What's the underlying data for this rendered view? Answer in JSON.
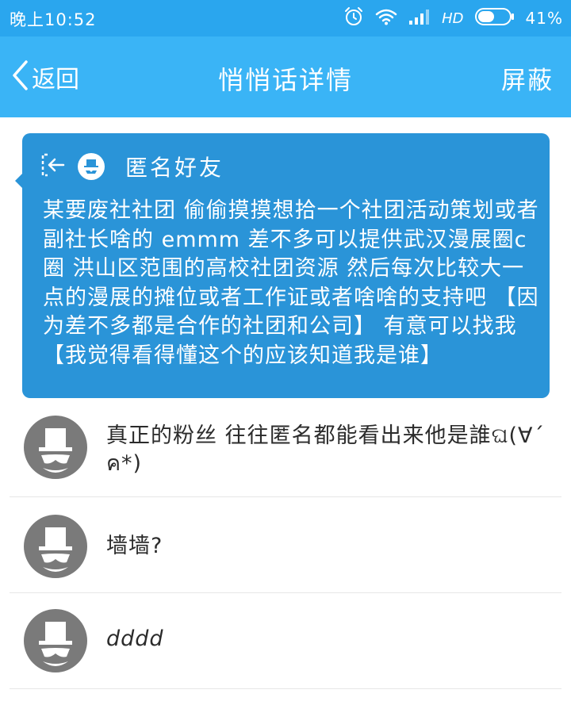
{
  "status_bar": {
    "time": "晚上10:52",
    "network": "HD",
    "battery_percent": "41%"
  },
  "nav": {
    "back_label": "返回",
    "title": "悄悄话详情",
    "block_label": "屏蔽"
  },
  "post": {
    "author": "匿名好友",
    "content": "某要废社社团 偷偷摸摸想拾一个社团活动策划或者副社长啥的 emmm 差不多可以提供武汉漫展圈c圈 洪山区范围的高校社团资源 然后每次比较大一点的漫展的摊位或者工作证或者啥啥的支持吧 【因为差不多都是合作的社团和公司】 有意可以找我【我觉得看得懂这个的应该知道我是谁】"
  },
  "comments": [
    {
      "text": "真正的粉丝 往往匿名都能看出来他是誰ଘ(∀ˊ ค*)"
    },
    {
      "text": "墙墙?"
    },
    {
      "text": "dddd"
    }
  ],
  "colors": {
    "status_bar": "#2aa6ee",
    "nav_bar": "#3ab4f6",
    "bubble": "#2a94d8",
    "avatar": "#7a7a7a"
  }
}
